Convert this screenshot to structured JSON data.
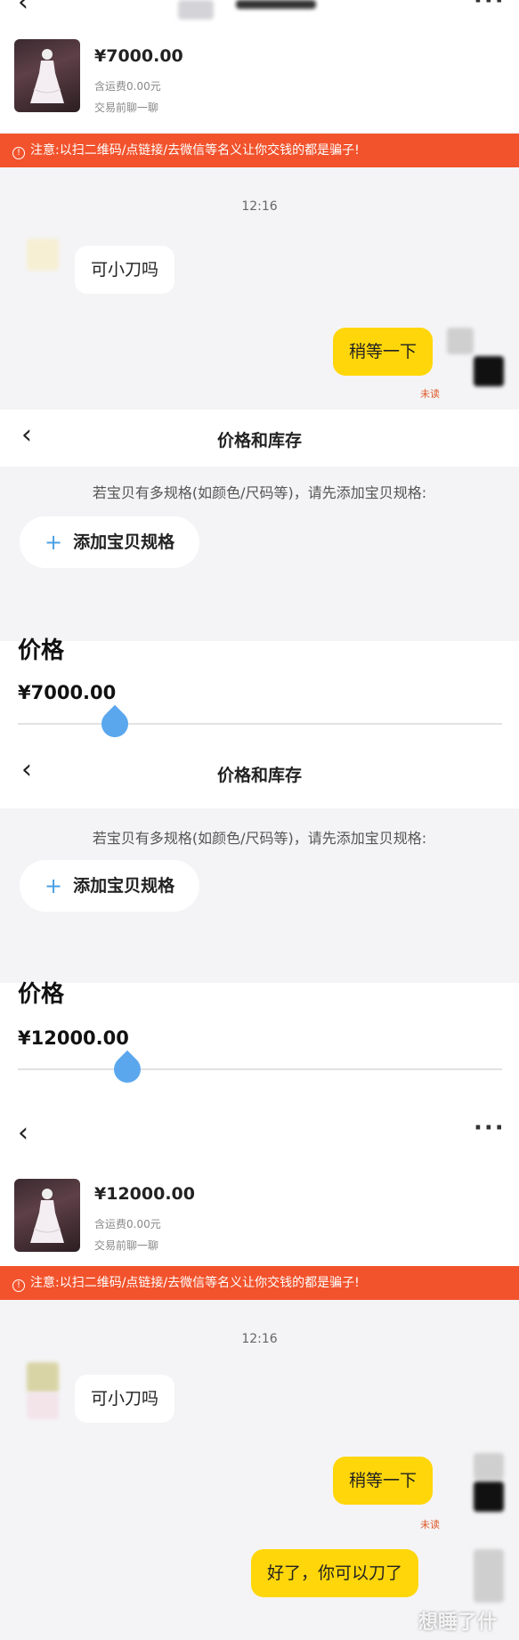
{
  "chat1": {
    "price": "¥7000.00",
    "shipping": "含运费0.00元",
    "trade_hint": "交易前聊一聊",
    "warning": "注意:以扫二维码/点链接/去微信等名义让你交钱的都是骗子!",
    "warning_icon": "info-icon",
    "time": "12:16",
    "msg_left": "可小刀吗",
    "msg_right": "稍等一下",
    "unread": "未读"
  },
  "editor1": {
    "title": "价格和库存",
    "hint": "若宝贝有多规格(如颜色/尺码等)，请先添加宝贝规格:",
    "add_label": "添加宝贝规格",
    "price_label": "价格",
    "price_value": "¥7000.00"
  },
  "editor2": {
    "title": "价格和库存",
    "hint": "若宝贝有多规格(如颜色/尺码等)，请先添加宝贝规格:",
    "add_label": "添加宝贝规格",
    "price_label": "价格",
    "price_value": "¥12000.00"
  },
  "chat2": {
    "price": "¥12000.00",
    "shipping": "含运费0.00元",
    "trade_hint": "交易前聊一聊",
    "warning": "注意:以扫二维码/点链接/去微信等名义让你交钱的都是骗子!",
    "time": "12:16",
    "msg_left": "可小刀吗",
    "msg_right1": "稍等一下",
    "unread": "未读",
    "msg_right2": "好了，你可以刀了"
  },
  "colors": {
    "accent_yellow": "#ffd60a",
    "warning_red": "#f2532c",
    "slider_blue": "#5aa7ee"
  },
  "watermark": "想睡了什"
}
